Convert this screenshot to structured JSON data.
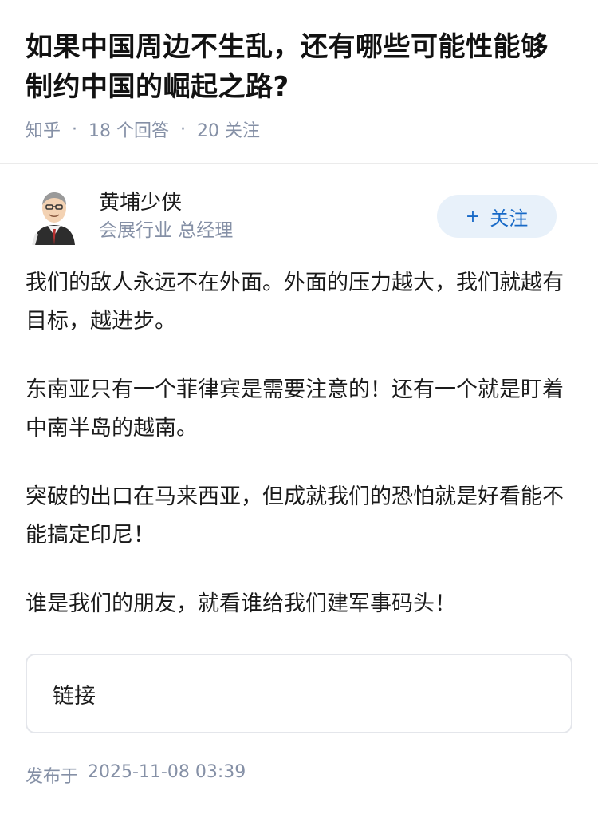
{
  "question": {
    "title": "如果中国周边不生乱，还有哪些可能性能够制约中国的崛起之路?",
    "source": "知乎",
    "answer_count": "18 个回答",
    "follower_count": "20 关注"
  },
  "answer": {
    "author_name": "黄埔少侠",
    "author_title": "会展行业 总经理",
    "follow_label": "关注",
    "follow_icon": "plus-icon",
    "paragraphs": [
      "我们的敌人永远不在外面。外面的压力越大，我们就越有目标，越进步。",
      "东南亚只有一个菲律宾是需要注意的！还有一个就是盯着中南半岛的越南。",
      "突破的出口在马来西亚，但成就我们的恐怕就是好看能不能搞定印尼！",
      "谁是我们的朋友，就看谁给我们建军事码头！"
    ],
    "link_card_label": "链接",
    "publish_label": "发布于",
    "publish_time": "2025-11-08 03:39"
  },
  "colors": {
    "accent": "#1769c7",
    "meta": "#8590a6",
    "follow_bg": "#e8f1fa"
  }
}
